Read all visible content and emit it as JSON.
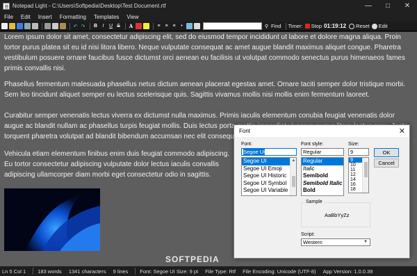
{
  "window": {
    "title": "Notepad Light - C:\\Users\\Softpedia\\Desktop\\Test Document.rtf"
  },
  "menu": [
    "File",
    "Edit",
    "Insert",
    "Formatting",
    "Templates",
    "View"
  ],
  "toolbar": {
    "find_label": "Find",
    "timer_label": "Timer:",
    "stop_label": "Stop",
    "timer_value": "01:19:12",
    "reset_label": "Reset",
    "edit_label": "Edit",
    "search_value": ""
  },
  "document": {
    "paragraphs": [
      "Lorem ipsum dolor sit amet, consectetur adipiscing elit, sed do eiusmod tempor incididunt ut labore et dolore magna aliqua. Proin tortor purus platea sit eu id nisi litora libero. Neque vulputate consequat ac amet augue blandit maximus aliquet congue. Pharetra vestibulum posuere ornare faucibus fusce dictumst orci aenean eu facilisis ut volutpat commodo senectus purus himenaeos fames primis convallis nisi.",
      "Phasellus fermentum malesuada phasellus netus dictum aenean placerat egestas amet. Ornare taciti semper dolor tristique morbi. Sem leo tincidunt aliquet semper eu lectus scelerisque quis. Sagittis vivamus mollis nisi mollis enim fermentum laoreet.",
      "Curabitur semper venenatis lectus viverra ex dictumst nulla maximus. Primis iaculis elementum conubia feugiat venenatis dolor augue ac blandit nullam ac phasellus turpis feugiat mollis. Duis lectus porta mattis imperdiet vivamus augue litora lectus arcu. Justo torquent pharetra volutpat ad blandit bibendum accumsan nec elit consequat.",
      "Vehicula etiam elementum finibus enim duis feugiat commodo adipiscing. Eu tortor consectetur adipiscing vulputate dolor lectus iaculis convallis adipiscing ullamcorper diam morbi eget consectetur odio in sagittis."
    ]
  },
  "status": {
    "position": "Ln 5  Col 1",
    "words": "183  words",
    "characters": "1341  characters",
    "lines": "9  lines",
    "font": "Font: Segoe UI Size: 9 pt",
    "file_type": "File Type:  Rtf",
    "encoding": "File Encoding:  Unicode (UTF-8)",
    "app_version": "App Version:  1.0.0.39"
  },
  "font_dialog": {
    "title": "Font",
    "close_glyph": "✕",
    "font_label": "Font:",
    "font_value": "Segoe UI",
    "fonts": [
      "Segoe UI",
      "Segoe UI Emoji",
      "Segoe UI Historic",
      "Segoe UI Symbol",
      "Segoe UI Variable"
    ],
    "style_label": "Font style:",
    "style_value": "Regular",
    "styles": [
      "Regular",
      "Italic",
      "Semibold",
      "Semibold Italic",
      "Bold"
    ],
    "size_label": "Size:",
    "size_value": "9",
    "sizes": [
      "9",
      "10",
      "11",
      "12",
      "14",
      "16",
      "18"
    ],
    "ok_label": "OK",
    "cancel_label": "Cancel",
    "sample_label": "Sample",
    "sample_text": "AaBbYyZz",
    "script_label": "Script:",
    "script_value": "Western"
  },
  "watermark": "SOFTPEDIA",
  "colors": {
    "editor_bg": "#5e5e5e",
    "chrome_bg": "#202020",
    "selection": "#0078d7",
    "stop_red": "#d9281e"
  }
}
